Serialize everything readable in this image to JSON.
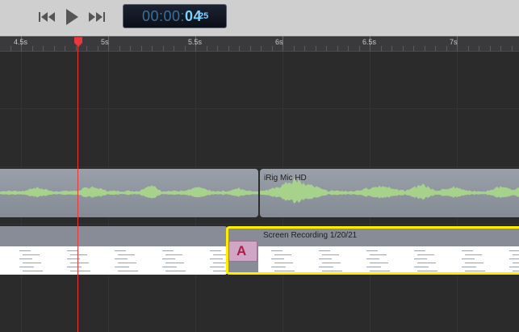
{
  "transport": {
    "rewind_icon": "rewind-icon",
    "play_icon": "play-icon",
    "forward_icon": "fast-forward-icon"
  },
  "timecode": {
    "dim": "00:00:",
    "seconds": "04",
    "frames": "25"
  },
  "ruler": {
    "labels": [
      "4.5s",
      "5s",
      "5.5s",
      "6s",
      "6.5s",
      "7s"
    ]
  },
  "tracks": {
    "audio_clip_name": "iRig Mic HD",
    "video_clip_name": "Screen Recording 1/20/21",
    "transition_glyph": "A"
  },
  "colors": {
    "playhead": "#e8383b",
    "selection": "#ffee00",
    "waveform": "#a7d28c"
  }
}
